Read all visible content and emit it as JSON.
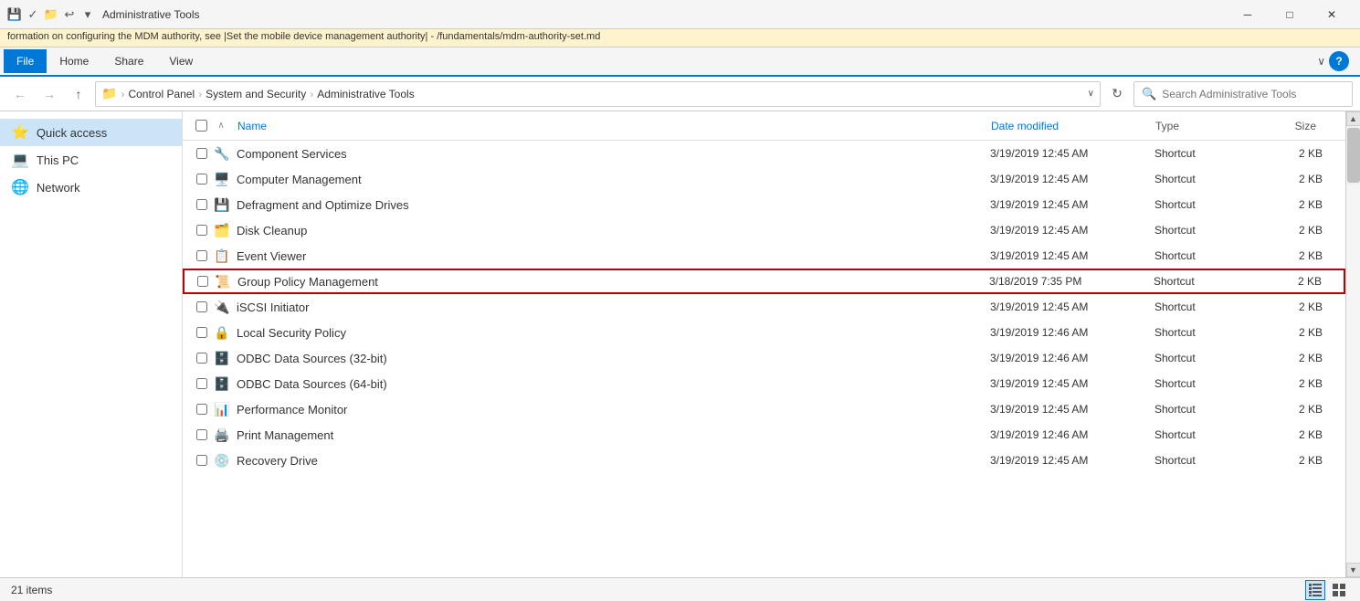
{
  "infobar": {
    "text": "formation on configuring the MDM authority, see |Set the mobile device management authority| - /fundamentals/mdm-authority-set.md"
  },
  "titlebar": {
    "title": "Administrative Tools",
    "minimize": "─",
    "maximize": "□",
    "close": "✕"
  },
  "ribbon": {
    "tabs": [
      "File",
      "Home",
      "Share",
      "View"
    ],
    "expand_arrow": "∨",
    "help": "?"
  },
  "addressbar": {
    "back": "←",
    "forward": "→",
    "up": "↑",
    "folder_icon": "📁",
    "breadcrumbs": [
      "Control Panel",
      "System and Security",
      "Administrative Tools"
    ],
    "dropdown": "∨",
    "refresh": "↻",
    "search_placeholder": "Search Administrative Tools"
  },
  "sidebar": {
    "items": [
      {
        "id": "quick-access",
        "label": "Quick access",
        "icon": "⭐",
        "active": true
      },
      {
        "id": "this-pc",
        "label": "This PC",
        "icon": "💻"
      },
      {
        "id": "network",
        "label": "Network",
        "icon": "🌐"
      }
    ]
  },
  "content": {
    "columns": {
      "name": "Name",
      "date_modified": "Date modified",
      "type": "Type",
      "size": "Size",
      "sort_arrow": "∧"
    },
    "files": [
      {
        "name": "Component Services",
        "date": "3/19/2019 12:45 AM",
        "type": "Shortcut",
        "size": "2 KB",
        "icon": "🔧",
        "highlighted": false
      },
      {
        "name": "Computer Management",
        "date": "3/19/2019 12:45 AM",
        "type": "Shortcut",
        "size": "2 KB",
        "icon": "🖥️",
        "highlighted": false
      },
      {
        "name": "Defragment and Optimize Drives",
        "date": "3/19/2019 12:45 AM",
        "type": "Shortcut",
        "size": "2 KB",
        "icon": "💾",
        "highlighted": false
      },
      {
        "name": "Disk Cleanup",
        "date": "3/19/2019 12:45 AM",
        "type": "Shortcut",
        "size": "2 KB",
        "icon": "🗂️",
        "highlighted": false
      },
      {
        "name": "Event Viewer",
        "date": "3/19/2019 12:45 AM",
        "type": "Shortcut",
        "size": "2 KB",
        "icon": "📋",
        "highlighted": false
      },
      {
        "name": "Group Policy Management",
        "date": "3/18/2019 7:35 PM",
        "type": "Shortcut",
        "size": "2 KB",
        "icon": "📜",
        "highlighted": true
      },
      {
        "name": "iSCSI Initiator",
        "date": "3/19/2019 12:45 AM",
        "type": "Shortcut",
        "size": "2 KB",
        "icon": "🔌",
        "highlighted": false
      },
      {
        "name": "Local Security Policy",
        "date": "3/19/2019 12:46 AM",
        "type": "Shortcut",
        "size": "2 KB",
        "icon": "🔒",
        "highlighted": false
      },
      {
        "name": "ODBC Data Sources (32-bit)",
        "date": "3/19/2019 12:46 AM",
        "type": "Shortcut",
        "size": "2 KB",
        "icon": "🗄️",
        "highlighted": false
      },
      {
        "name": "ODBC Data Sources (64-bit)",
        "date": "3/19/2019 12:45 AM",
        "type": "Shortcut",
        "size": "2 KB",
        "icon": "🗄️",
        "highlighted": false
      },
      {
        "name": "Performance Monitor",
        "date": "3/19/2019 12:45 AM",
        "type": "Shortcut",
        "size": "2 KB",
        "icon": "📊",
        "highlighted": false
      },
      {
        "name": "Print Management",
        "date": "3/19/2019 12:46 AM",
        "type": "Shortcut",
        "size": "2 KB",
        "icon": "🖨️",
        "highlighted": false
      },
      {
        "name": "Recovery Drive",
        "date": "3/19/2019 12:45 AM",
        "type": "Shortcut",
        "size": "2 KB",
        "icon": "💿",
        "highlighted": false
      }
    ]
  },
  "statusbar": {
    "item_count": "21 items",
    "view_details_icon": "≡",
    "view_tiles_icon": "⊞"
  }
}
